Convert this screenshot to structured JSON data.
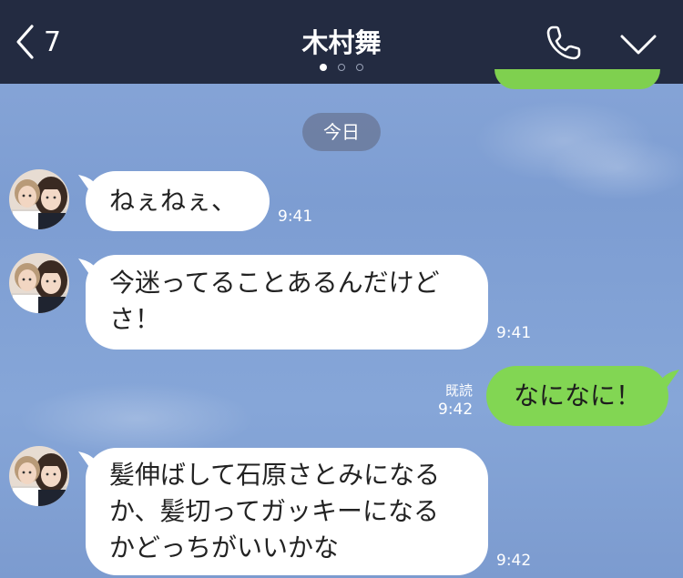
{
  "header": {
    "back_count": "7",
    "title": "木村舞",
    "page_dots": 3,
    "active_dot": 0
  },
  "date_divider": "今日",
  "messages": [
    {
      "side": "received",
      "lines": [
        "ねぇねぇ、"
      ],
      "time": "9:41"
    },
    {
      "side": "received",
      "lines": [
        "今迷ってることあるんだけど",
        "さ！"
      ],
      "time": "9:41"
    },
    {
      "side": "sent",
      "lines": [
        "なになに！"
      ],
      "time": "9:42",
      "read": "既読"
    },
    {
      "side": "received",
      "lines": [
        "髪伸ばして石原さとみになる",
        "か、髪切ってガッキーになる",
        "かどっちがいいかな"
      ],
      "time": "9:42"
    }
  ],
  "colors": {
    "header_bg": "#232b41",
    "chat_bg": "#86a5d8",
    "sent_bubble": "#82d653",
    "received_bubble": "#ffffff",
    "date_pill": "#687694"
  },
  "icons": {
    "back": "chevron-left-icon",
    "call": "phone-icon",
    "menu": "chevron-down-icon"
  }
}
